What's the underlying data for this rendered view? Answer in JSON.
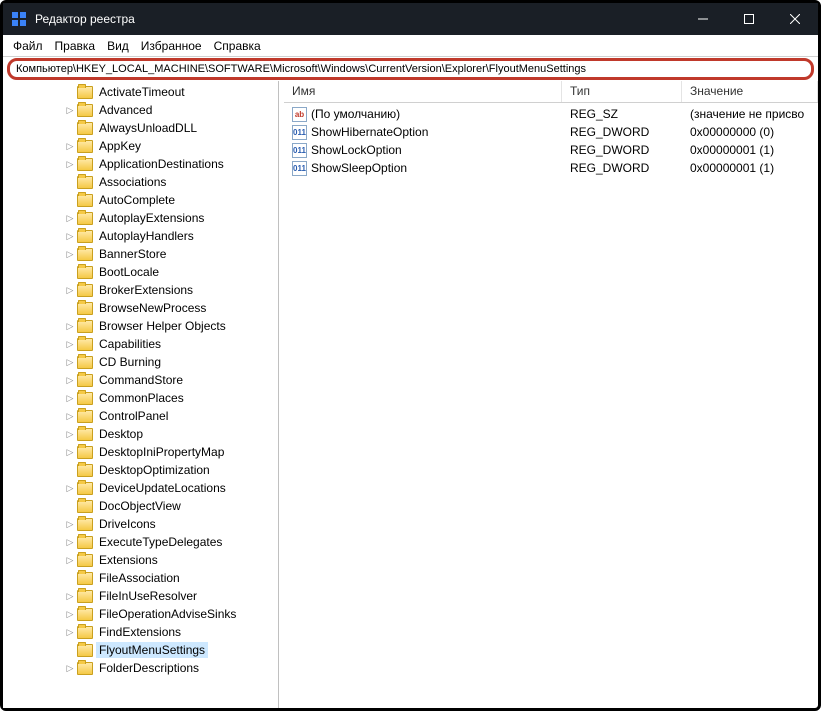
{
  "window": {
    "title": "Редактор реестра"
  },
  "menu": {
    "file": "Файл",
    "edit": "Правка",
    "view": "Вид",
    "favorites": "Избранное",
    "help": "Справка"
  },
  "address": "Компьютер\\HKEY_LOCAL_MACHINE\\SOFTWARE\\Microsoft\\Windows\\CurrentVersion\\Explorer\\FlyoutMenuSettings",
  "tree": [
    {
      "label": "ActivateTimeout",
      "expand": "none",
      "depth": 4
    },
    {
      "label": "Advanced",
      "expand": "closed",
      "depth": 4
    },
    {
      "label": "AlwaysUnloadDLL",
      "expand": "none",
      "depth": 4
    },
    {
      "label": "AppKey",
      "expand": "closed",
      "depth": 4
    },
    {
      "label": "ApplicationDestinations",
      "expand": "closed",
      "depth": 4
    },
    {
      "label": "Associations",
      "expand": "none",
      "depth": 4
    },
    {
      "label": "AutoComplete",
      "expand": "none",
      "depth": 4
    },
    {
      "label": "AutoplayExtensions",
      "expand": "closed",
      "depth": 4
    },
    {
      "label": "AutoplayHandlers",
      "expand": "closed",
      "depth": 4
    },
    {
      "label": "BannerStore",
      "expand": "closed",
      "depth": 4
    },
    {
      "label": "BootLocale",
      "expand": "none",
      "depth": 4
    },
    {
      "label": "BrokerExtensions",
      "expand": "closed",
      "depth": 4
    },
    {
      "label": "BrowseNewProcess",
      "expand": "none",
      "depth": 4
    },
    {
      "label": "Browser Helper Objects",
      "expand": "closed",
      "depth": 4
    },
    {
      "label": "Capabilities",
      "expand": "closed",
      "depth": 4
    },
    {
      "label": "CD Burning",
      "expand": "closed",
      "depth": 4
    },
    {
      "label": "CommandStore",
      "expand": "closed",
      "depth": 4
    },
    {
      "label": "CommonPlaces",
      "expand": "closed",
      "depth": 4
    },
    {
      "label": "ControlPanel",
      "expand": "closed",
      "depth": 4
    },
    {
      "label": "Desktop",
      "expand": "closed",
      "depth": 4
    },
    {
      "label": "DesktopIniPropertyMap",
      "expand": "closed",
      "depth": 4
    },
    {
      "label": "DesktopOptimization",
      "expand": "none",
      "depth": 4
    },
    {
      "label": "DeviceUpdateLocations",
      "expand": "closed",
      "depth": 4
    },
    {
      "label": "DocObjectView",
      "expand": "none",
      "depth": 4
    },
    {
      "label": "DriveIcons",
      "expand": "closed",
      "depth": 4
    },
    {
      "label": "ExecuteTypeDelegates",
      "expand": "closed",
      "depth": 4
    },
    {
      "label": "Extensions",
      "expand": "closed",
      "depth": 4
    },
    {
      "label": "FileAssociation",
      "expand": "none",
      "depth": 4
    },
    {
      "label": "FileInUseResolver",
      "expand": "closed",
      "depth": 4
    },
    {
      "label": "FileOperationAdviseSinks",
      "expand": "closed",
      "depth": 4
    },
    {
      "label": "FindExtensions",
      "expand": "closed",
      "depth": 4
    },
    {
      "label": "FlyoutMenuSettings",
      "expand": "none",
      "depth": 4,
      "selected": true
    },
    {
      "label": "FolderDescriptions",
      "expand": "closed",
      "depth": 4
    }
  ],
  "columns": {
    "name": "Имя",
    "type": "Тип",
    "value": "Значение"
  },
  "values": [
    {
      "icon": "str",
      "name": "(По умолчанию)",
      "type": "REG_SZ",
      "data": "(значение не присво"
    },
    {
      "icon": "bin",
      "name": "ShowHibernateOption",
      "type": "REG_DWORD",
      "data": "0x00000000 (0)"
    },
    {
      "icon": "bin",
      "name": "ShowLockOption",
      "type": "REG_DWORD",
      "data": "0x00000001 (1)"
    },
    {
      "icon": "bin",
      "name": "ShowSleepOption",
      "type": "REG_DWORD",
      "data": "0x00000001 (1)"
    }
  ],
  "icons": {
    "str": "ab",
    "bin": "011"
  }
}
